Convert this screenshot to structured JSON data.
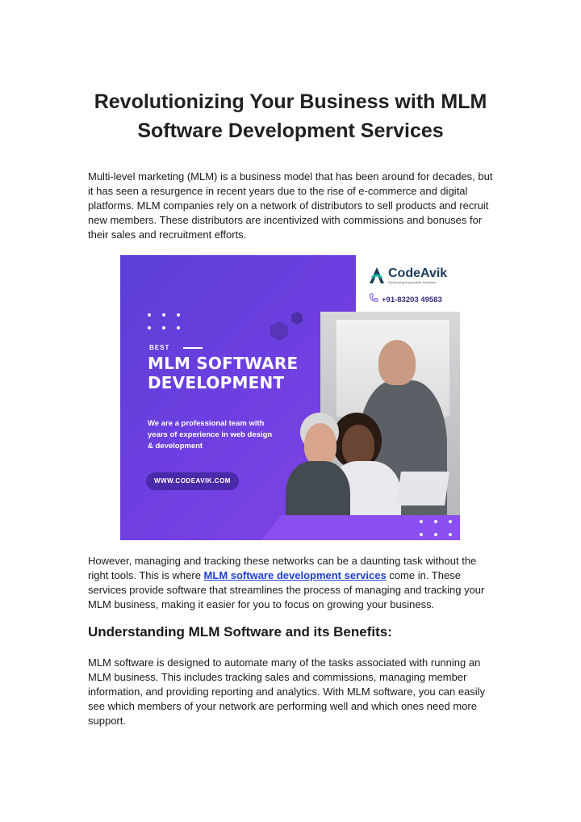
{
  "article": {
    "title": "Revolutionizing Your Business with MLM Software Development Services",
    "intro": "Multi-level marketing (MLM) is a business model that has been around for decades, but it has seen a resurgence in recent years due to the rise of e-commerce and digital platforms. MLM companies rely on a network of distributors to sell products and recruit new members. These distributors are incentivized with commissions and bonuses for their sales and recruitment efforts.",
    "para2_before": "However, managing and tracking these networks can be a daunting task without the right tools. This is where ",
    "para2_link": "MLM software development services",
    "para2_after": " come in. These services provide software that streamlines the process of managing and tracking your MLM business, making it easier for you to focus on growing your business.",
    "section_heading": "Understanding MLM Software and its Benefits:",
    "para3": "MLM software is designed to automate many of the tasks associated with running an MLM business. This includes tracking sales and commissions, managing member information, and providing reporting and analytics. With MLM software, you can easily see which members of your network are performing well and which ones need more support."
  },
  "banner": {
    "kicker": "BEST",
    "title_line1": "MLM SOFTWARE",
    "title_line2": "DEVELOPMENT",
    "description": "We are a professional team with years of experience in web design & development",
    "url": "WWW.CODEAVIK.COM",
    "logo_name": "CodeAvik",
    "logo_tagline": "Developing Impeccable Solutions",
    "phone": "+91-83203 49583",
    "colors": {
      "purple_dark": "#5a3fd6",
      "purple_light": "#8a45ea",
      "logo_teal": "#1fb3a8",
      "logo_navy": "#1b3b5a"
    },
    "icons": [
      "codeavik-logo-icon",
      "phone-icon"
    ]
  }
}
